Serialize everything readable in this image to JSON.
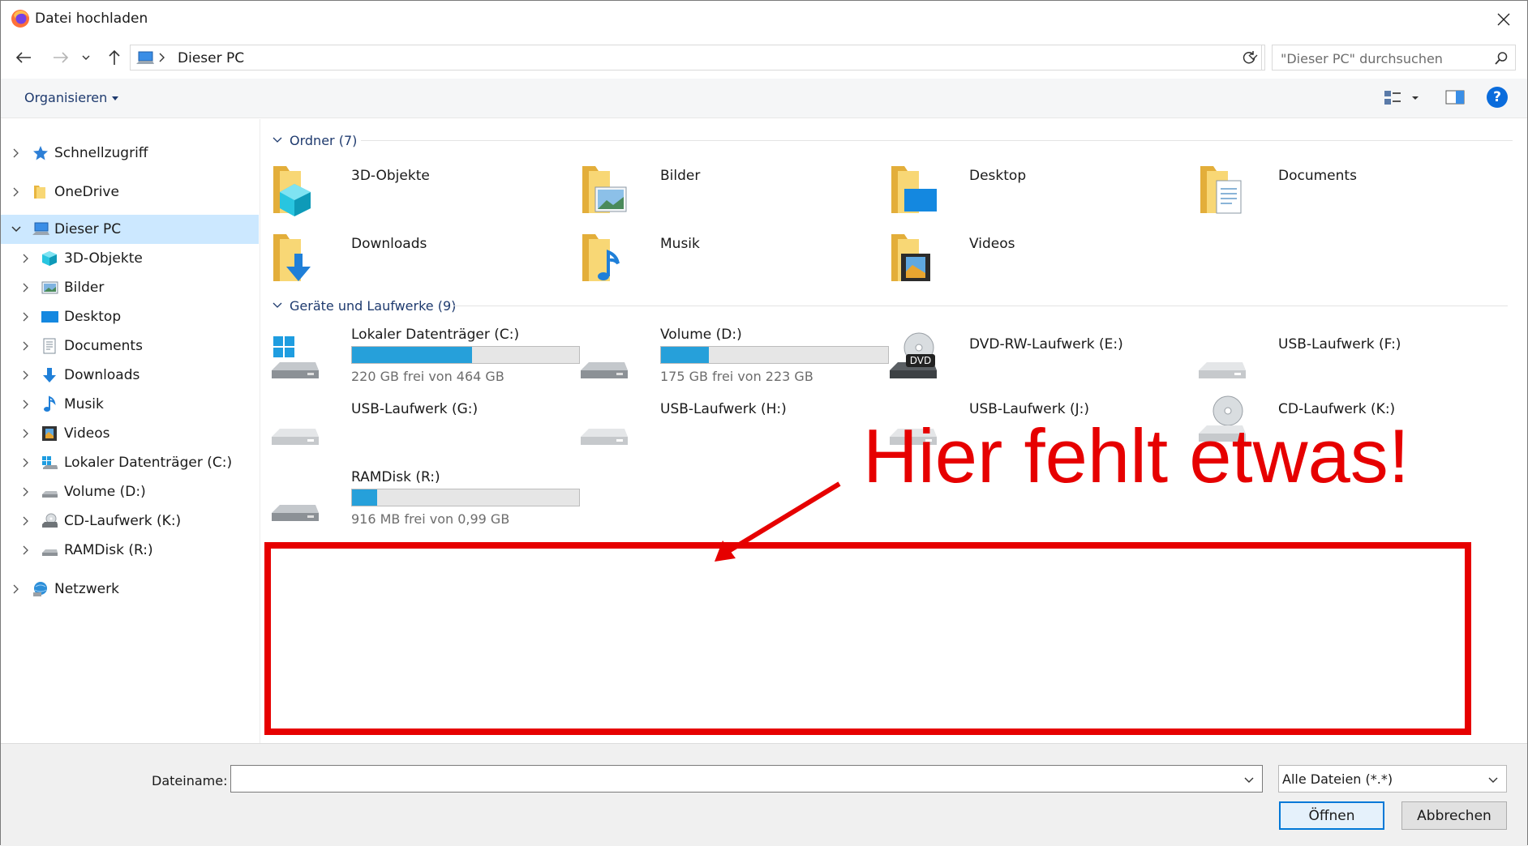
{
  "window": {
    "title": "Datei hochladen"
  },
  "nav": {
    "address": "Dieser PC",
    "search_placeholder": "\"Dieser PC\" durchsuchen"
  },
  "commandbar": {
    "organize": "Organisieren",
    "help": "?"
  },
  "sidebar": {
    "items": [
      {
        "label": "Schnellzugriff",
        "icon": "star-icon"
      },
      {
        "label": "OneDrive",
        "icon": "folder-icon"
      },
      {
        "label": "Dieser PC",
        "icon": "pc-icon",
        "selected": true
      },
      {
        "label": "3D-Objekte",
        "icon": "cube-icon"
      },
      {
        "label": "Bilder",
        "icon": "picture-icon"
      },
      {
        "label": "Desktop",
        "icon": "desktop-icon"
      },
      {
        "label": "Documents",
        "icon": "document-icon"
      },
      {
        "label": "Downloads",
        "icon": "download-icon"
      },
      {
        "label": "Musik",
        "icon": "music-icon"
      },
      {
        "label": "Videos",
        "icon": "video-icon"
      },
      {
        "label": "Lokaler Datenträger (C:)",
        "icon": "windows-drive-icon"
      },
      {
        "label": "Volume (D:)",
        "icon": "drive-icon"
      },
      {
        "label": "CD-Laufwerk (K:)",
        "icon": "cd-drive-icon"
      },
      {
        "label": "RAMDisk (R:)",
        "icon": "drive-icon"
      },
      {
        "label": "Netzwerk",
        "icon": "network-icon"
      }
    ]
  },
  "content": {
    "folders_header": "Ordner (7)",
    "folders": [
      {
        "name": "3D-Objekte",
        "icon": "cube-folder-icon"
      },
      {
        "name": "Bilder",
        "icon": "picture-folder-icon"
      },
      {
        "name": "Desktop",
        "icon": "desktop-folder-icon"
      },
      {
        "name": "Documents",
        "icon": "document-folder-icon"
      },
      {
        "name": "Downloads",
        "icon": "download-folder-icon"
      },
      {
        "name": "Musik",
        "icon": "music-folder-icon"
      },
      {
        "name": "Videos",
        "icon": "video-folder-icon"
      }
    ],
    "drives_header": "Geräte und Laufwerke (9)",
    "drives": [
      {
        "name": "Lokaler Datenträger (C:)",
        "free": "220 GB frei von 464 GB",
        "used_fraction": 0.53,
        "icon": "windows-drive-icon"
      },
      {
        "name": "Volume (D:)",
        "free": "175 GB frei von 223 GB",
        "used_fraction": 0.21,
        "icon": "drive-icon"
      },
      {
        "name": "DVD-RW-Laufwerk (E:)",
        "icon": "dvd-drive-icon",
        "dvd_label": "DVD"
      },
      {
        "name": "USB-Laufwerk (F:)",
        "icon": "usb-drive-icon"
      },
      {
        "name": "USB-Laufwerk (G:)",
        "icon": "usb-drive-icon"
      },
      {
        "name": "USB-Laufwerk (H:)",
        "icon": "usb-drive-icon"
      },
      {
        "name": "USB-Laufwerk (J:)",
        "icon": "usb-drive-icon"
      },
      {
        "name": "CD-Laufwerk (K:)",
        "icon": "cd-drive-icon"
      },
      {
        "name": "RAMDisk (R:)",
        "free": "916 MB frei von 0,99 GB",
        "used_fraction": 0.11,
        "icon": "drive-icon"
      }
    ]
  },
  "bottom": {
    "filename_label": "Dateiname:",
    "filename_value": "",
    "filetype": "Alle Dateien (*.*)",
    "open_button": "Öffnen",
    "cancel_button": "Abbrechen"
  },
  "annotation": {
    "text": "Hier fehlt etwas!",
    "color": "#e60000"
  },
  "colors": {
    "accent": "#0078d7",
    "selection": "#cce8ff",
    "bar_fill": "#26a0da"
  }
}
